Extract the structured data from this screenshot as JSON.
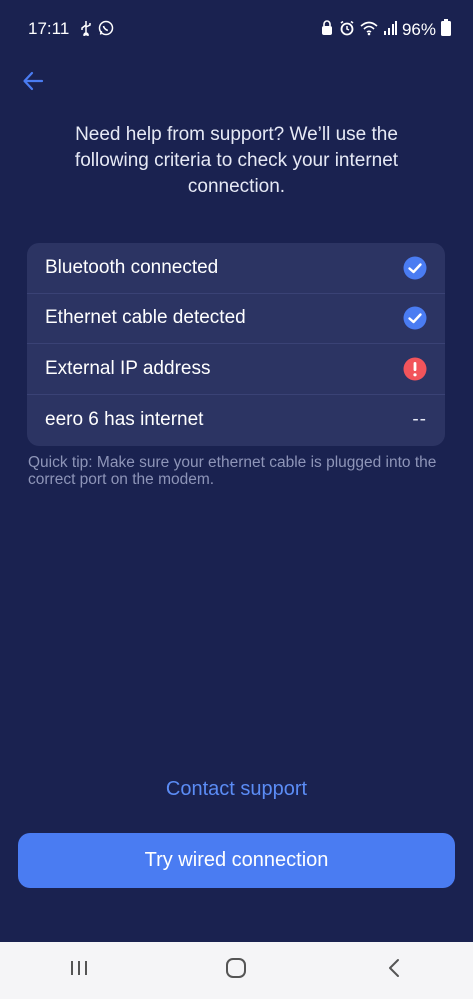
{
  "status_bar": {
    "time": "17:11",
    "battery": "96%",
    "left_icons": [
      "usb-icon",
      "whatsapp-icon"
    ],
    "right_icons": [
      "lock-icon",
      "alarm-icon",
      "wifi-icon",
      "signal-icon",
      "battery-icon"
    ]
  },
  "header": {
    "back_icon": "arrow-left-icon"
  },
  "intro": {
    "text": "Need help from support? We’ll use the following criteria to check your internet connection."
  },
  "checklist": {
    "items": [
      {
        "label": "Bluetooth connected",
        "status": "ok",
        "icon": "check-circle-icon"
      },
      {
        "label": "Ethernet cable detected",
        "status": "ok",
        "icon": "check-circle-icon"
      },
      {
        "label": "External IP address",
        "status": "error",
        "icon": "error-circle-icon"
      },
      {
        "label": "eero 6 has internet",
        "status": "pending",
        "status_text": "--"
      }
    ]
  },
  "quick_tip": "Quick tip: Make sure your ethernet cable is plugged into the correct port on the modem.",
  "contact_support_label": "Contact support",
  "primary_button_label": "Try wired connection",
  "colors": {
    "background": "#1a2250",
    "card": "#2c3463",
    "accent": "#4a7cf2",
    "link": "#5b8cf5",
    "ok": "#4a7cf2",
    "error": "#f2545b"
  },
  "nav_bar": {
    "buttons": [
      "recent-apps-icon",
      "home-icon",
      "back-nav-icon"
    ]
  }
}
